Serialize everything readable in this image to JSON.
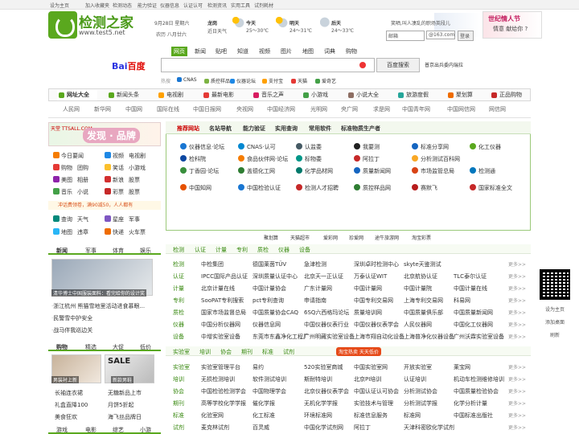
{
  "topbar": {
    "items": [
      "设为主页",
      "加入收藏夹",
      "检测动态",
      "能力验证",
      "仪器信息",
      "认证认可",
      "检测资讯",
      "实用工具",
      "试剂耗材"
    ]
  },
  "logo": {
    "name": "检测之家",
    "url": "www.test5.net"
  },
  "date": {
    "line1": "9月28日 星期六",
    "line2": "农历 八月廿六"
  },
  "weather": {
    "city": "龙岗",
    "city_sub": "近日天气",
    "days": [
      {
        "label": "今天",
        "temp": "25～30℃"
      },
      {
        "label": "明天",
        "temp": "24～31℃"
      },
      {
        "label": "后天",
        "temp": "24～33℃"
      }
    ]
  },
  "ad_top": {
    "small": "笑晒,叫人凄乱的职场英段儿",
    "title": "世纪情人节",
    "sub": "情意 献给你 ?"
  },
  "mail": {
    "user_placeholder": "邮箱",
    "domain": "@163.com",
    "login": "登录"
  },
  "baidu": {
    "tabs": [
      "网页",
      "新闻",
      "贴吧",
      "知道",
      "视频",
      "图片",
      "地图",
      "词典",
      "购物"
    ],
    "logo_a": "Bai",
    "logo_b": "du",
    "logo_c": "百度",
    "button": "百度搜索",
    "location": "普京出兵委内瑞拉",
    "hot_label": "热搜",
    "hot": [
      "CNAS",
      "质控样品",
      "仪器论坛",
      "支付宝",
      "天猫",
      "爱奇艺"
    ]
  },
  "nav": {
    "items": [
      "网址大全",
      "新闻头条",
      "电视剧",
      "最新电影",
      "音乐之声",
      "小游戏",
      "小说大全",
      "旅游度假",
      "聚划算",
      "正品购物"
    ],
    "sub": [
      "人民网",
      "新华网",
      "中国网",
      "国际在线",
      "中国日报网",
      "央视网",
      "中国经济网",
      "光明网",
      "央广网",
      "求是网",
      "中国青年网",
      "中国网信网",
      "网信网"
    ]
  },
  "side": {
    "ad_left": "天堂 TTSALL.COM",
    "ad_text": "发现 · 品牌",
    "grid": [
      [
        "今日要闻",
        "视频",
        "电视剧"
      ],
      [
        "购物",
        "团购",
        "笑话",
        "小游戏"
      ],
      [
        "美图",
        "相册",
        "新浪",
        "股票"
      ],
      [
        "音乐",
        "小说",
        "彩票",
        "股票"
      ]
    ],
    "promo": "冲话费领卷，满90减50，人人都有",
    "grid2": [
      [
        "查询",
        "天气",
        "星座",
        "军事"
      ],
      [
        "地图",
        "违章",
        "快递",
        "火车票"
      ]
    ],
    "news_tabs": [
      "新闻",
      "军事",
      "体育",
      "娱乐"
    ],
    "news_caption": "清华博士中国服装面料：看完给你的设计奖",
    "news": [
      "浙江杭州 熊猫雪地里活动进食慕眼...",
      "民警雪中护安全",
      "战马伴我巡边关"
    ],
    "shop_tabs": [
      "购物",
      "精选",
      "大促",
      "低价"
    ],
    "shop_caption1": "男装衬上新",
    "shop_caption2": "新款男鞋",
    "sale": "SALE",
    "shop": [
      [
        "长袖连衣裙",
        "无糖新品上市"
      ],
      [
        "礼盒直降100",
        "月饼5折起"
      ],
      [
        "美食狂欢",
        "海飞丝品牌日"
      ]
    ],
    "bottom_tabs": [
      "游戏",
      "电影",
      "综艺",
      "小游"
    ]
  },
  "main": {
    "tabs": [
      "推荐网站",
      "名站导航",
      "能力验证",
      "实用查询",
      "常用软件",
      "标准物质生产者"
    ],
    "sites": [
      [
        "仪器信息·论坛",
        "CNAS·认可",
        "认监委",
        "我要测",
        "标准分享网",
        "化工仪器"
      ],
      [
        "检科院",
        "食品伙伴网·论坛",
        "标物委",
        "阿拉丁",
        "分析测试百科网",
        ""
      ],
      [
        "丁香园·论坛",
        "盖德化工网",
        "化学品材网",
        "质量新闻网",
        "市场监管总局",
        "检测通"
      ],
      [
        "中国知网",
        "中国检验认证",
        "检测人才招聘",
        "质控样品网",
        "赛默飞",
        "国家标准全文"
      ]
    ],
    "bottom_links": [
      "聚划算",
      "天猫超市",
      "爱彩网",
      "珍爱网",
      "途牛旅游网",
      "淘宝彩票"
    ]
  },
  "dir1": {
    "tags": [
      "检测",
      "认证",
      "计量",
      "专利",
      "质检",
      "仪器",
      "设备"
    ],
    "rows": [
      {
        "h": "检测",
        "items": [
          "中检集团",
          "德国莱茵TÜV",
          "急津检测",
          "深圳卓时检测中心",
          "skyte天鉴测试"
        ]
      },
      {
        "h": "认证",
        "items": [
          "IPCC国际产品认证",
          "深圳质量认证中心",
          "北京天一正认证",
          "万泰认证WIT",
          "北京航协认证",
          "TLC泰尔认证"
        ]
      },
      {
        "h": "计量",
        "items": [
          "北京计量在线",
          "中国计量协会",
          "广东计量网",
          "中国计量网",
          "中国计量院",
          "中国计量在线"
        ]
      },
      {
        "h": "专利",
        "items": [
          "SooPAT专利搜索",
          "pct专利查询",
          "申请指南",
          "中国专利交易网",
          "上海专利交易网",
          "科易网"
        ]
      },
      {
        "h": "质检",
        "items": [
          "国家市场监督总局",
          "中国质量协会CAQ",
          "6SQ六西格玛论坛",
          "质量培训网",
          "中国质量俱乐部",
          "中国质量新闻网"
        ]
      },
      {
        "h": "仪器",
        "items": [
          "中国分析仪器网",
          "仪器信息网",
          "中国仪器仪表行业",
          "中国仪器仪表学会",
          "人民仪器网",
          "中国化工仪器网"
        ]
      },
      {
        "h": "设备",
        "items": [
          "中增实验室设备",
          "东莞市东鑫净化工程厂",
          "广州明藏实验室设备",
          "上海市翔自动化设备",
          "上海普净化仪器设备",
          "广州沃霖实验室设备"
        ]
      }
    ],
    "more": "更多>>"
  },
  "dir2": {
    "tags": [
      "实验室",
      "培训",
      "协会",
      "期刊",
      "标准",
      "试剂"
    ],
    "badge": "淘宝热卖 天天低价",
    "rows": [
      {
        "h": "实验室",
        "items": [
          "实验室管理平台",
          "易约",
          "520实验室商城",
          "中国实验室网",
          "开放实验室",
          "莱宝网"
        ]
      },
      {
        "h": "培训",
        "items": [
          "无损检测培训",
          "软件测试培训",
          "斯耐特培训",
          "北京PI培训",
          "认证培训",
          "机动车检测维修培训"
        ]
      },
      {
        "h": "协会",
        "items": [
          "中国检验检测学会",
          "中国物理学会",
          "北京仪器仪表学会",
          "中国认证认可协会",
          "分析测试协会",
          "中国质量检验协会"
        ]
      },
      {
        "h": "期刊",
        "items": [
          "高等学校化学学报",
          "催化学报",
          "无机化学学报",
          "实验技术与管理",
          "分析测试学报",
          "化学分析计量"
        ]
      },
      {
        "h": "标准",
        "items": [
          "化验室网",
          "化工标准",
          "环境标准网",
          "标准信息服务",
          "标准网",
          "中国标准出版社"
        ]
      },
      {
        "h": "试剂",
        "items": [
          "麦克林试剂",
          "百灵威",
          "中国化学试剂网",
          "阿拉丁",
          "天津科密欧化学试剂"
        ]
      }
    ],
    "more": "更多>>"
  },
  "right": {
    "b1": "设为主页",
    "b2": "添加桌面",
    "b3": "刷新"
  },
  "colors": {
    "brand": "#5aa81e",
    "link_hot": "#c00",
    "accent": "#2932e1"
  }
}
